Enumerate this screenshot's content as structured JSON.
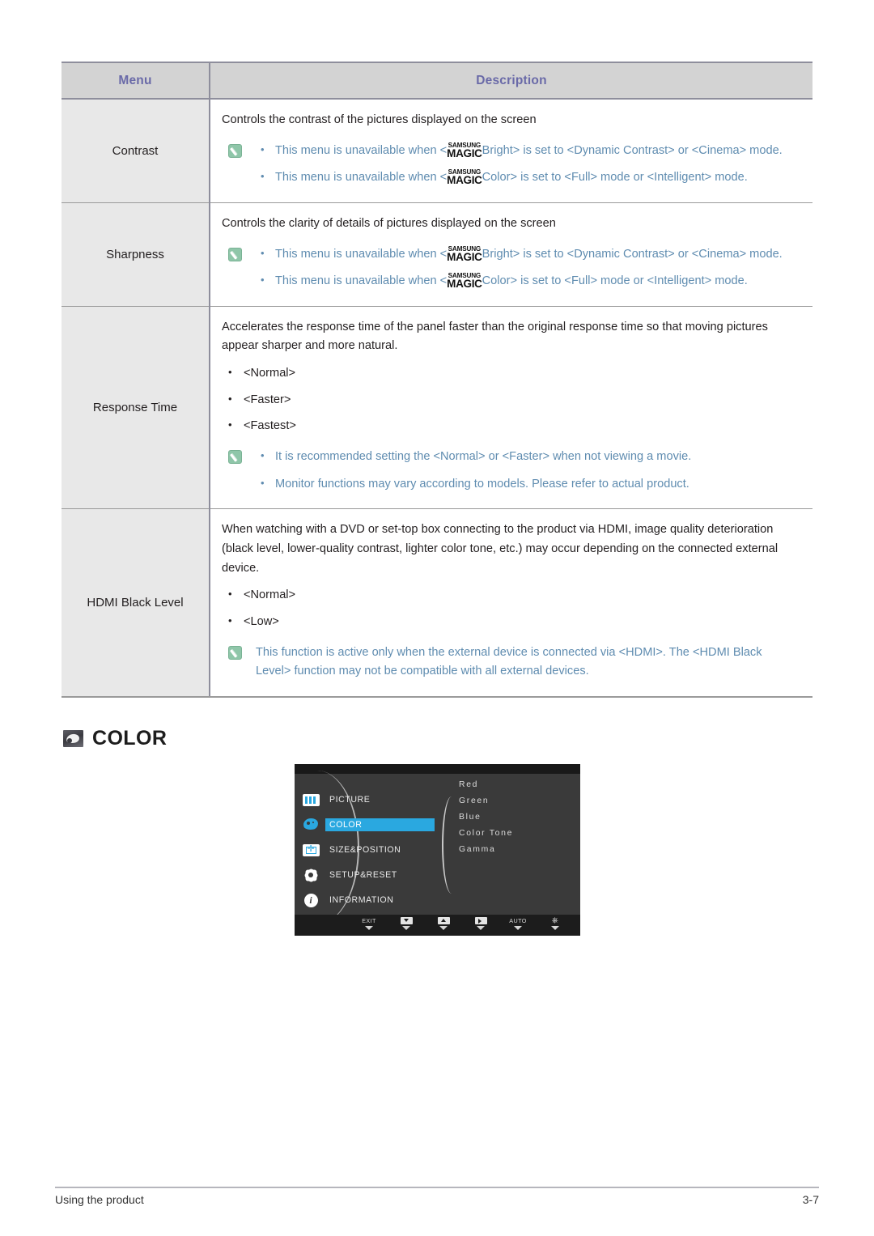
{
  "table": {
    "headers": {
      "menu": "Menu",
      "description": "Description"
    },
    "rows": [
      {
        "menu": "Contrast",
        "lead": "Controls the contrast of the pictures displayed on the screen",
        "note_bullets": [
          {
            "pre": "This menu is unavailable when <",
            "logo_top": "SAMSUNG",
            "logo_bottom": "MAGIC",
            "post": "Bright> is set to <Dynamic Contrast> or <Cinema> mode."
          },
          {
            "pre": "This menu is unavailable when <",
            "logo_top": "SAMSUNG",
            "logo_bottom": "MAGIC",
            "post": "Color> is set to <Full> mode or <Intelligent> mode."
          }
        ]
      },
      {
        "menu": "Sharpness",
        "lead": "Controls the clarity of details of pictures displayed on the screen",
        "note_bullets": [
          {
            "pre": "This menu is unavailable when <",
            "logo_top": "SAMSUNG",
            "logo_bottom": "MAGIC",
            "post": "Bright> is set to <Dynamic Contrast> or <Cinema> mode."
          },
          {
            "pre": "This menu is unavailable when <",
            "logo_top": "SAMSUNG",
            "logo_bottom": "MAGIC",
            "post": "Color> is set to <Full> mode or <Intelligent> mode."
          }
        ]
      },
      {
        "menu": "Response Time",
        "lead": "Accelerates the response time of the panel faster than the original response time so that moving pictures appear sharper and more natural.",
        "options": [
          "<Normal>",
          "<Faster>",
          "<Fastest>"
        ],
        "note_bullets": [
          "It is recommended setting the <Normal> or <Faster> when not viewing a movie.",
          "Monitor functions may vary according to models. Please refer to actual product."
        ]
      },
      {
        "menu": "HDMI Black Level",
        "lead": "When watching with a DVD or set-top box connecting to the product via HDMI, image quality deterioration (black level, lower-quality contrast, lighter color tone, etc.) may occur depending on the connected external device.",
        "options": [
          "<Normal>",
          "<Low>"
        ],
        "note_text": "This function is active only when the external device is connected via <HDMI>. The <HDMI Black Level> function may not be compatible with all external devices."
      }
    ]
  },
  "section": {
    "icon": "color-palette-icon",
    "title": "COLOR"
  },
  "osd": {
    "menu_items": [
      {
        "label": "PICTURE",
        "icon": "picture-icon",
        "selected": false
      },
      {
        "label": "COLOR",
        "icon": "color-icon",
        "selected": true
      },
      {
        "label": "SIZE&POSITION",
        "icon": "size-position-icon",
        "selected": false
      },
      {
        "label": "SETUP&RESET",
        "icon": "gear-icon",
        "selected": false
      },
      {
        "label": "INFORMATION",
        "icon": "info-icon",
        "selected": false
      }
    ],
    "submenu_items": [
      "Red",
      "Green",
      "Blue",
      "Color Tone",
      "Gamma"
    ],
    "buttons": [
      {
        "caption": "EXIT",
        "glyph": "none"
      },
      {
        "caption": "",
        "glyph": "down"
      },
      {
        "caption": "",
        "glyph": "up"
      },
      {
        "caption": "",
        "glyph": "right"
      },
      {
        "caption": "AUTO",
        "glyph": "none"
      },
      {
        "caption": "",
        "glyph": "power"
      }
    ],
    "highlight_color": "#2aa8e0"
  },
  "footer": {
    "left": "Using the product",
    "right": "3-7"
  }
}
